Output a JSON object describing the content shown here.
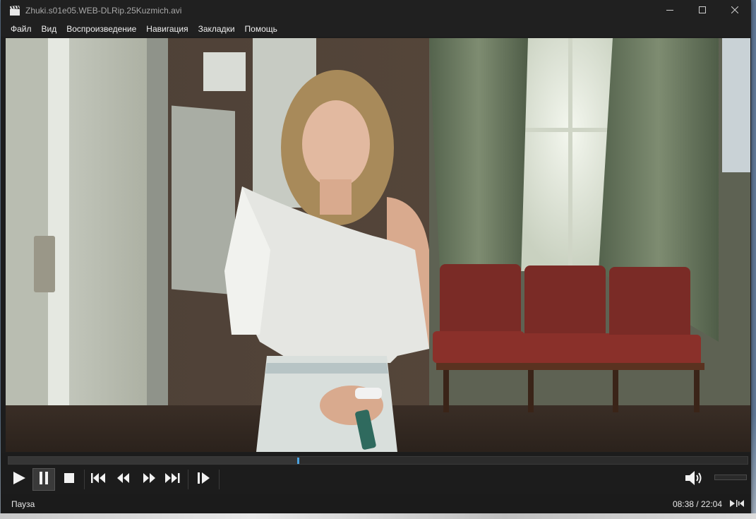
{
  "window": {
    "title": "Zhuki.s01e05.WEB-DLRip.25Kuzmich.avi",
    "app_icon": "clapperboard-icon",
    "controls": [
      "minimize-icon",
      "maximize-icon",
      "close-icon"
    ]
  },
  "menu": {
    "items": [
      "Файл",
      "Вид",
      "Воспроизведение",
      "Навигация",
      "Закладки",
      "Помощь"
    ]
  },
  "seek": {
    "progress": 0.392
  },
  "playback": {
    "buttons": [
      "play-icon",
      "pause-icon",
      "stop-icon",
      "previous-icon",
      "rewind-icon",
      "fast-forward-icon",
      "next-icon",
      "frame-step-icon"
    ],
    "active_button": "pause",
    "volume_icon": "speaker-icon",
    "volume_level": 0.0
  },
  "status": {
    "state": "Пауза",
    "time": "08:38 / 22:04",
    "icon": "signal-bars-icon"
  },
  "colors": {
    "seek_handle": "#4ba3e0",
    "chrome_background": "#1c1c1c"
  }
}
